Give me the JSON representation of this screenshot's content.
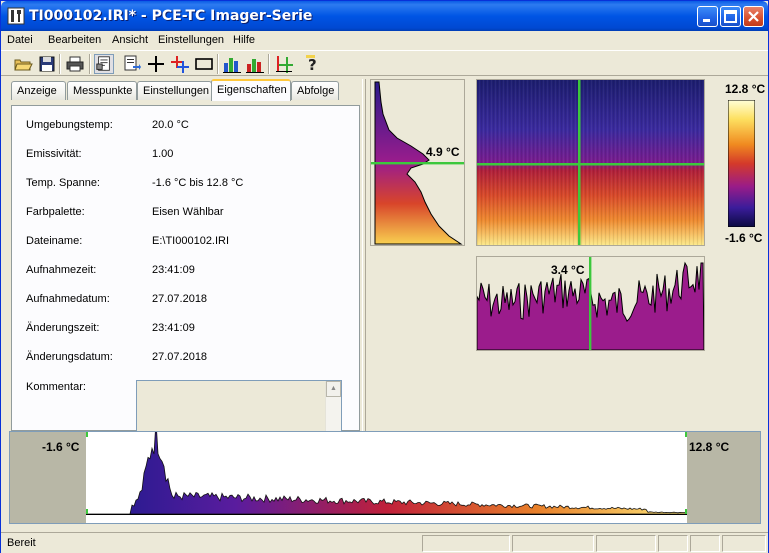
{
  "window": {
    "title": "TI000102.IRI* - PCE-TC Imager-Serie"
  },
  "menu": {
    "items": [
      "Datei",
      "Bearbeiten",
      "Ansicht",
      "Einstellungen",
      "Hilfe"
    ]
  },
  "toolbar": {
    "icons": [
      "open-folder-icon",
      "save-icon",
      "print-icon",
      "properties-icon",
      "export-icon",
      "crosshair-icon",
      "multi-point-icon",
      "rectangle-icon",
      "bar-chart-icon",
      "bar-chart-alt-icon",
      "crosshair-chart-icon",
      "help-icon"
    ]
  },
  "tabs": [
    "Anzeige",
    "Messpunkte",
    "Einstellungen",
    "Eigenschaften",
    "Abfolge"
  ],
  "active_tab": "Eigenschaften",
  "properties": [
    {
      "label": "Umgebungstemp:",
      "value": "20.0 °C"
    },
    {
      "label": "Emissivität:",
      "value": "1.00"
    },
    {
      "label": "Temp. Spanne:",
      "value": "-1.6 °C bis 12.8 °C"
    },
    {
      "label": "Farbpalette:",
      "value": "Eisen Wählbar"
    },
    {
      "label": "Dateiname:",
      "value": "E:\\TI000102.IRI"
    },
    {
      "label": "Aufnahmezeit:",
      "value": "23:41:09"
    },
    {
      "label": "Aufnahmedatum:",
      "value": "27.07.2018"
    },
    {
      "label": "Änderungszeit:",
      "value": "23:41:09"
    },
    {
      "label": "Änderungsdatum:",
      "value": "27.07.2018"
    },
    {
      "label": "Kommentar:",
      "value": ""
    }
  ],
  "thermal": {
    "vertical_profile_temp": "4.9 °C",
    "horizontal_profile_temp": "3.4 °C",
    "scale_max": "12.8 °C",
    "scale_min": "-1.6 °C"
  },
  "histogram": {
    "min_label": "-1.6 °C",
    "max_label": "12.8 °C"
  },
  "status": {
    "text": "Bereit"
  },
  "colors": {
    "xp_blue": "#0055E5",
    "crosshair": "#3CC83C",
    "profile_purple": "#9B1C8C"
  }
}
